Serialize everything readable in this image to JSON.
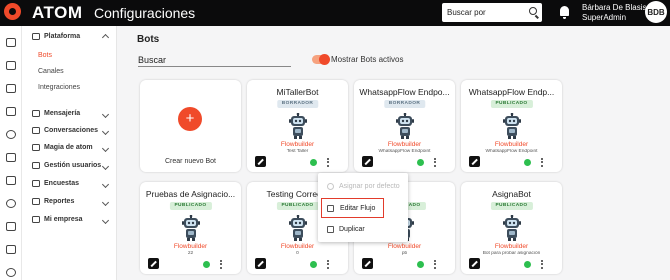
{
  "header": {
    "brand": "ATOM",
    "section": "Configuraciones",
    "search_placeholder": "Buscar por",
    "user_name": "Bárbara De Blasis",
    "user_role": "SuperAdmin",
    "avatar_initials": "BDB",
    "brand_color": "#f04a2a"
  },
  "sidebar": {
    "groups": [
      {
        "label": "Plataforma",
        "icon": "plataforma-icon",
        "expanded": true,
        "items": [
          {
            "label": "Bots",
            "active": true
          },
          {
            "label": "Canales"
          },
          {
            "label": "Integraciones"
          }
        ]
      },
      {
        "label": "Mensajería",
        "icon": "mensajeria-icon"
      },
      {
        "label": "Conversaciones",
        "icon": "conversaciones-icon"
      },
      {
        "label": "Magia de atom",
        "icon": "magia-icon"
      },
      {
        "label": "Gestión usuarios",
        "icon": "usuarios-icon"
      },
      {
        "label": "Encuestas",
        "icon": "encuestas-icon"
      },
      {
        "label": "Reportes",
        "icon": "reportes-icon"
      },
      {
        "label": "Mi empresa",
        "icon": "empresa-icon"
      }
    ]
  },
  "main": {
    "title": "Bots",
    "filter_placeholder": "Buscar",
    "toggle_label": "Mostrar Bots activos",
    "toggle_on": true,
    "create_label": "Crear nuevo Bot",
    "cards": [
      {
        "name": "MiTallerBot",
        "status": "BORRADOR",
        "type": "Flowbuilder",
        "desc": "Test Taller"
      },
      {
        "name": "WhatsappFlow Endpo...",
        "status": "BORRADOR",
        "type": "Flowbuilder",
        "desc": "WhatsappFlow Endpoint"
      },
      {
        "name": "WhatsappFlow Endp...",
        "status": "PUBLICADO",
        "type": "Flowbuilder",
        "desc": "WhatsappFlow Endpoint"
      },
      {
        "name": "Pruebas de Asignacio...",
        "status": "PUBLICADO",
        "type": "Flowbuilder",
        "desc": "22"
      },
      {
        "name": "Testing Correc...",
        "status": "PUBLICADO",
        "type": "Flowbuilder",
        "desc": "0"
      },
      {
        "name": "",
        "status": "PUBLICADO",
        "type": "Flowbuilder",
        "desc": "pb"
      },
      {
        "name": "AsignaBot",
        "status": "PUBLICADO",
        "type": "Flowbuilder",
        "desc": "Bot para probar asignación"
      }
    ]
  },
  "context_menu": {
    "items": [
      {
        "label": "Asignar por defecto",
        "disabled": true,
        "icon": "assign-default-icon"
      },
      {
        "label": "Editar Flujo",
        "highlighted": true,
        "icon": "flow-icon"
      },
      {
        "label": "Duplicar",
        "icon": "duplicate-icon"
      }
    ]
  }
}
